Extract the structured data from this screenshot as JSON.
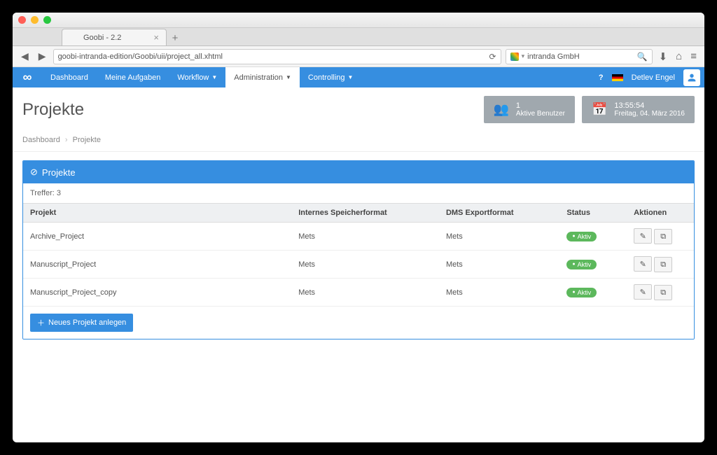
{
  "browser": {
    "tab_title": "Goobi - 2.2",
    "url": "goobi-intranda-edition/Goobi/uii/project_all.xhtml",
    "search_placeholder": "intranda GmbH"
  },
  "nav": {
    "items": [
      "Dashboard",
      "Meine Aufgaben",
      "Workflow",
      "Administration",
      "Controlling"
    ],
    "user_name": "Detlev Engel"
  },
  "header": {
    "page_title": "Projekte",
    "users_count": "1",
    "users_label": "Aktive Benutzer",
    "time": "13:55:54",
    "date": "Freitag, 04. März 2016"
  },
  "breadcrumb": {
    "root": "Dashboard",
    "current": "Projekte"
  },
  "panel": {
    "title": "Projekte",
    "hits_label": "Treffer: 3",
    "columns": [
      "Projekt",
      "Internes Speicherformat",
      "DMS Exportformat",
      "Status",
      "Aktionen"
    ],
    "rows": [
      {
        "name": "Archive_Project",
        "internal": "Mets",
        "dms": "Mets",
        "status": "Aktiv"
      },
      {
        "name": "Manuscript_Project",
        "internal": "Mets",
        "dms": "Mets",
        "status": "Aktiv"
      },
      {
        "name": "Manuscript_Project_copy",
        "internal": "Mets",
        "dms": "Mets",
        "status": "Aktiv"
      }
    ],
    "new_button": "Neues Projekt anlegen"
  }
}
